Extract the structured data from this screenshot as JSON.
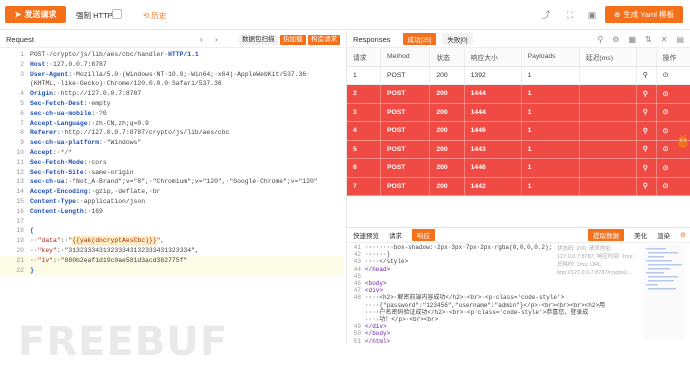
{
  "topbar": {
    "send_label": "发送请求",
    "force_https_label": "强制 HTTPS",
    "history_label": "历史",
    "yaml_label": "生成 Yaml 模板"
  },
  "request": {
    "title": "Request",
    "packet_label": "数据包扫描",
    "hot_label": "热加载",
    "construct_label": "构造请求",
    "lines": [
      {
        "n": "1",
        "parts": [
          [
            "val",
            "POST·/crypto/js/lib/aes/cbc/handler·"
          ],
          [
            "key",
            "HTTP/1.1"
          ]
        ]
      },
      {
        "n": "2",
        "parts": [
          [
            "key",
            "Host"
          ],
          [
            "val",
            ":·127.0.0.7:8787"
          ]
        ]
      },
      {
        "n": "3",
        "parts": [
          [
            "key",
            "User-Agent"
          ],
          [
            "val",
            ":·Mozilla/5.0·(Windows·NT·10.0;·Win64;·x64)·AppleWebKit/537.36·"
          ]
        ]
      },
      {
        "n": "",
        "parts": [
          [
            "val",
            "(KHTML,·like·Gecko)·Chrome/120.0.0.0·Safari/537.36"
          ]
        ]
      },
      {
        "n": "4",
        "parts": [
          [
            "key",
            "Origin"
          ],
          [
            "val",
            ":·http://127.0.0.7:8787"
          ]
        ]
      },
      {
        "n": "5",
        "parts": [
          [
            "key",
            "Sec-Fetch-Dest"
          ],
          [
            "val",
            ":·empty"
          ]
        ]
      },
      {
        "n": "6",
        "parts": [
          [
            "key",
            "sec-ch-ua-mobile"
          ],
          [
            "val",
            ":·?0"
          ]
        ]
      },
      {
        "n": "7",
        "parts": [
          [
            "key",
            "Accept-Language"
          ],
          [
            "val",
            ":·zh-CN,zh;q=0.9"
          ]
        ]
      },
      {
        "n": "8",
        "parts": [
          [
            "key",
            "Referer"
          ],
          [
            "val",
            ":·http://127.0.0.7:8787/crypto/js/lib/aes/cbc"
          ]
        ]
      },
      {
        "n": "9",
        "parts": [
          [
            "key",
            "sec-ch-ua-platform"
          ],
          [
            "val",
            ":·\"Windows\""
          ]
        ]
      },
      {
        "n": "10",
        "parts": [
          [
            "key",
            "Accept"
          ],
          [
            "val",
            ":·*/*"
          ]
        ]
      },
      {
        "n": "11",
        "parts": [
          [
            "key",
            "Sec-Fetch-Mode"
          ],
          [
            "val",
            ":·cors"
          ]
        ]
      },
      {
        "n": "12",
        "parts": [
          [
            "key",
            "Sec-Fetch-Site"
          ],
          [
            "val",
            ":·same-origin"
          ]
        ]
      },
      {
        "n": "13",
        "parts": [
          [
            "key",
            "sec-ch-ua"
          ],
          [
            "val",
            ":·\"Not_A·Brand\";v=\"8\",·\"Chromium\";v=\"120\",·\"Google·Chrome\";v=\"120\""
          ]
        ]
      },
      {
        "n": "14",
        "parts": [
          [
            "key",
            "Accept-Encoding"
          ],
          [
            "val",
            ":·gzip,·deflate,·br"
          ]
        ]
      },
      {
        "n": "15",
        "parts": [
          [
            "key",
            "Content-Type"
          ],
          [
            "val",
            ":·application/json"
          ]
        ]
      },
      {
        "n": "16",
        "parts": [
          [
            "key",
            "Content-Length"
          ],
          [
            "val",
            ":·169"
          ]
        ]
      },
      {
        "n": "17",
        "parts": [
          [
            "val",
            ""
          ]
        ]
      },
      {
        "n": "18",
        "parts": [
          [
            "key",
            "{"
          ]
        ]
      },
      {
        "n": "19",
        "parts": [
          [
            "val",
            "··"
          ],
          [
            "str",
            "\"data\""
          ],
          [
            "val",
            ":·\""
          ],
          [
            "hl",
            "{{yak(dncryptAesCbc)}}"
          ],
          [
            "val",
            "\","
          ]
        ]
      },
      {
        "n": "20",
        "parts": [
          [
            "val",
            "··"
          ],
          [
            "str",
            "\"key\""
          ],
          [
            "val",
            ":·\"31323334313233343132333431323334\","
          ]
        ]
      },
      {
        "n": "21",
        "parts": [
          [
            "val",
            "··"
          ],
          [
            "str",
            "\"iv\""
          ],
          [
            "val",
            ":·\"880b2eaf1d19c0ae581d3acd382775f\""
          ]
        ]
      },
      {
        "n": "22",
        "parts": [
          [
            "key",
            "}"
          ]
        ]
      }
    ]
  },
  "responses": {
    "title": "Responses",
    "success_tab": "成功[25]",
    "fail_tab": "失败[0]",
    "columns": [
      "请求",
      "Method",
      "状态",
      "响应大小",
      "Payloads",
      "延迟(ms)",
      "",
      "操作"
    ],
    "rows": [
      {
        "id": "1",
        "method": "POST",
        "status": "200",
        "size": "1392",
        "payload": "1",
        "delay": ""
      },
      {
        "id": "2",
        "method": "POST",
        "status": "200",
        "size": "1444",
        "payload": "1",
        "delay": ""
      },
      {
        "id": "3",
        "method": "POST",
        "status": "200",
        "size": "1444",
        "payload": "1",
        "delay": ""
      },
      {
        "id": "4",
        "method": "POST",
        "status": "200",
        "size": "1446",
        "payload": "1",
        "delay": ""
      },
      {
        "id": "5",
        "method": "POST",
        "status": "200",
        "size": "1443",
        "payload": "1",
        "delay": ""
      },
      {
        "id": "6",
        "method": "POST",
        "status": "200",
        "size": "1446",
        "payload": "1",
        "delay": ""
      },
      {
        "id": "7",
        "method": "POST",
        "status": "200",
        "size": "1442",
        "payload": "1",
        "delay": ""
      }
    ]
  },
  "bottom": {
    "preview_label": "快速预览",
    "request_label": "请求",
    "response_label": "响应",
    "extract_label": "提取数据",
    "beautify_label": "美化",
    "render_label": "渲染",
    "tooltip": "状态码: 200; 请求地址: 127.0.0.7:8787; 响应时间: 1ms; 总耗时: 1ms; URL: http://127.0.0.7:8787/crypto/j...",
    "lines": [
      {
        "n": "41",
        "html": "········box-shadow:·2px·3px·7px·2px·rgba(0,0,0,0.2);"
      },
      {
        "n": "42",
        "html": "······}"
      },
      {
        "n": "43",
        "html": "····</style>"
      },
      {
        "n": "44",
        "html": "</head>"
      },
      {
        "n": "45",
        "html": ""
      },
      {
        "n": "46",
        "html": "<body>"
      },
      {
        "n": "47",
        "html": "<div>"
      },
      {
        "n": "48",
        "html": "····<h2>·解密前端内容成功</h2>·<br>·<p·class='code-style'>"
      },
      {
        "n": "",
        "html": "····{\"password\":\"123456\",\"username\":\"admin\"}</p>·<br><br><br><h2>用"
      },
      {
        "n": "",
        "html": "····户名密码验证成功</h2>·<br>·<p·class='code-style'>恭喜您，登录成"
      },
      {
        "n": "",
        "html": "····功！</p>·<br><br>"
      },
      {
        "n": "49",
        "html": "</div>"
      },
      {
        "n": "50",
        "html": "</body>"
      },
      {
        "n": "51",
        "html": "</html>"
      }
    ]
  },
  "watermark": "FREEBUF",
  "colors": {
    "accent": "#f5701b",
    "row_red": "#f04a44",
    "status_green": "#36b36b"
  }
}
